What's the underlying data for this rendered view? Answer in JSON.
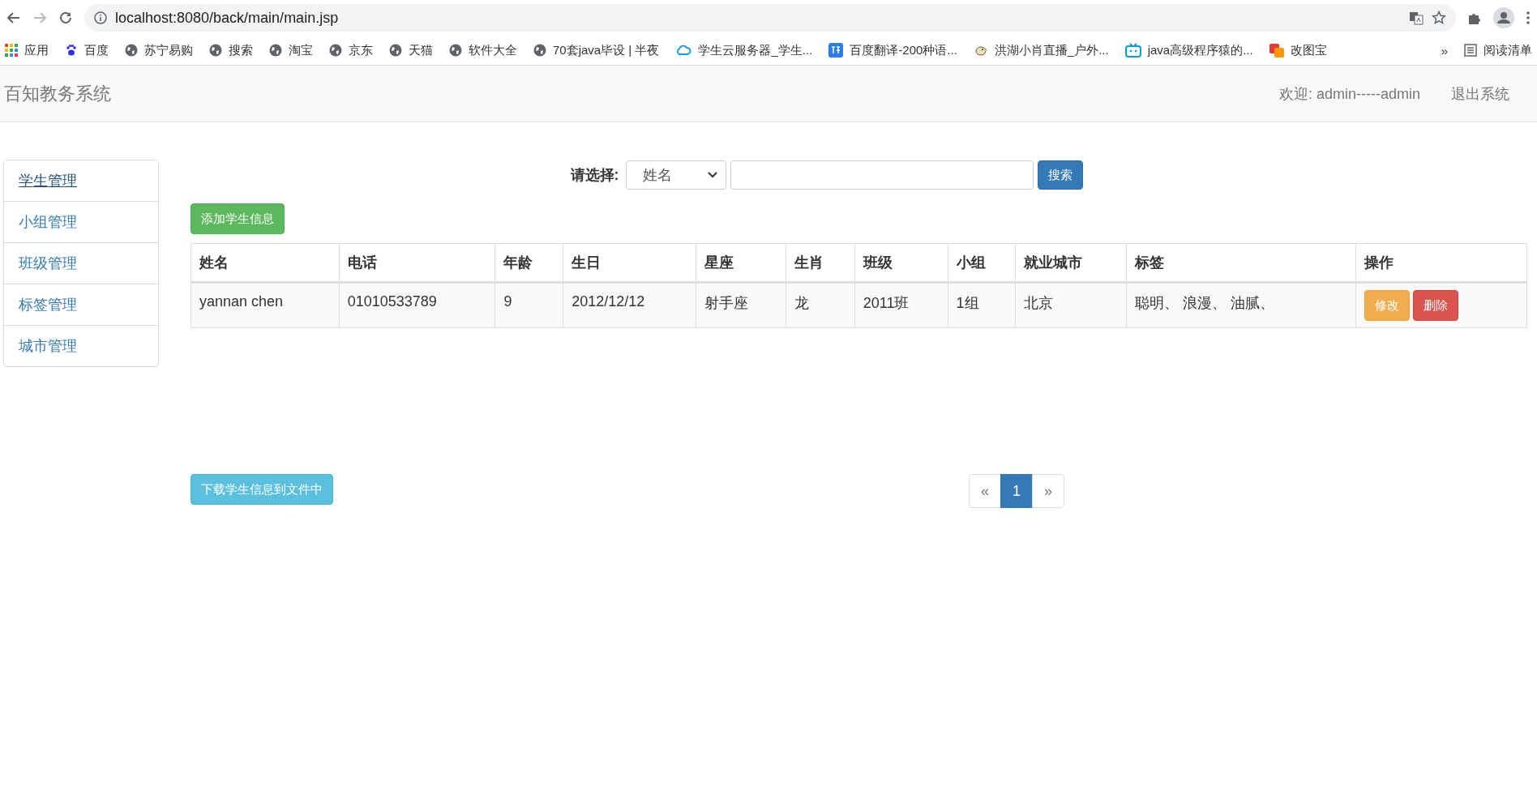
{
  "browser": {
    "url": "localhost:8080/back/main/main.jsp",
    "bookmarks": [
      {
        "label": "应用",
        "kind": "apps"
      },
      {
        "label": "百度",
        "kind": "paw"
      },
      {
        "label": "苏宁易购",
        "kind": "globe"
      },
      {
        "label": "搜索",
        "kind": "globe"
      },
      {
        "label": "淘宝",
        "kind": "globe"
      },
      {
        "label": "京东",
        "kind": "globe"
      },
      {
        "label": "天猫",
        "kind": "globe"
      },
      {
        "label": "软件大全",
        "kind": "globe"
      },
      {
        "label": "70套java毕设 | 半夜",
        "kind": "globe"
      },
      {
        "label": "学生云服务器_学生...",
        "kind": "cloud"
      },
      {
        "label": "百度翻译-200种语...",
        "kind": "translate"
      },
      {
        "label": "洪湖小肖直播_户外...",
        "kind": "bird"
      },
      {
        "label": "java高级程序猿的...",
        "kind": "tv"
      },
      {
        "label": "改图宝",
        "kind": "squares"
      }
    ],
    "more": "»",
    "reading_list": "阅读清单"
  },
  "header": {
    "title": "百知教务系统",
    "welcome": "欢迎: admin-----admin",
    "logout": "退出系统"
  },
  "sidebar": {
    "items": [
      {
        "label": "学生管理",
        "selected": true
      },
      {
        "label": "小组管理",
        "selected": false
      },
      {
        "label": "班级管理",
        "selected": false
      },
      {
        "label": "标签管理",
        "selected": false
      },
      {
        "label": "城市管理",
        "selected": false
      }
    ]
  },
  "search": {
    "label": "请选择:",
    "field": "姓名",
    "button": "搜索"
  },
  "add_button": "添加学生信息",
  "table": {
    "columns": [
      "姓名",
      "电话",
      "年龄",
      "生日",
      "星座",
      "生肖",
      "班级",
      "小组",
      "就业城市",
      "标签",
      "操作"
    ],
    "rows": [
      {
        "cells": [
          "yannan chen",
          "01010533789",
          "9",
          "2012/12/12",
          "射手座",
          "龙",
          "2011班",
          "1组",
          "北京",
          "聪明、 浪漫、 油腻、"
        ],
        "actions": [
          {
            "label": "修改",
            "kind": "warning"
          },
          {
            "label": "删除",
            "kind": "danger"
          }
        ]
      }
    ]
  },
  "download_button": "下载学生信息到文件中",
  "pagination": {
    "prev": "«",
    "pages": [
      {
        "label": "1",
        "selected": true
      }
    ],
    "next": "»"
  }
}
